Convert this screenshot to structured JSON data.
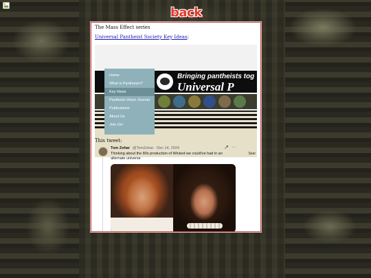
{
  "page": {
    "back_label": "back"
  },
  "panel": {
    "title": "The Mass Effect series",
    "link_text": "Universal Pantheist Society Key Ideas",
    "link_suffix": ":",
    "tweet_label": "This tweet:"
  },
  "website_screenshot": {
    "tagline": "Bringing pantheists tog",
    "site_name": "Universal P",
    "search_label": "Sear",
    "menu": [
      {
        "label": "Home"
      },
      {
        "label": "What is Pantheism?"
      },
      {
        "label": "Key Ideas"
      },
      {
        "label": "Pantheist Vision Journal"
      },
      {
        "label": "Publications"
      },
      {
        "label": "About Us"
      },
      {
        "label": "Join Us!"
      }
    ],
    "active_menu_index": 2
  },
  "tweet": {
    "author_name": "Tom Zohar",
    "author_handle": "@TomZohar · Dec 14, 2024",
    "body": "Thinking about the 80s production of Wicked we could've had in an alternate universe",
    "grok_icon": "grok-icon",
    "more_icon": "more-icon"
  },
  "colors": {
    "panel_border": "#b84a4a",
    "link": "#1a1ab5",
    "back": "#e13b2f",
    "menu_bg": "#8fb1ba"
  }
}
